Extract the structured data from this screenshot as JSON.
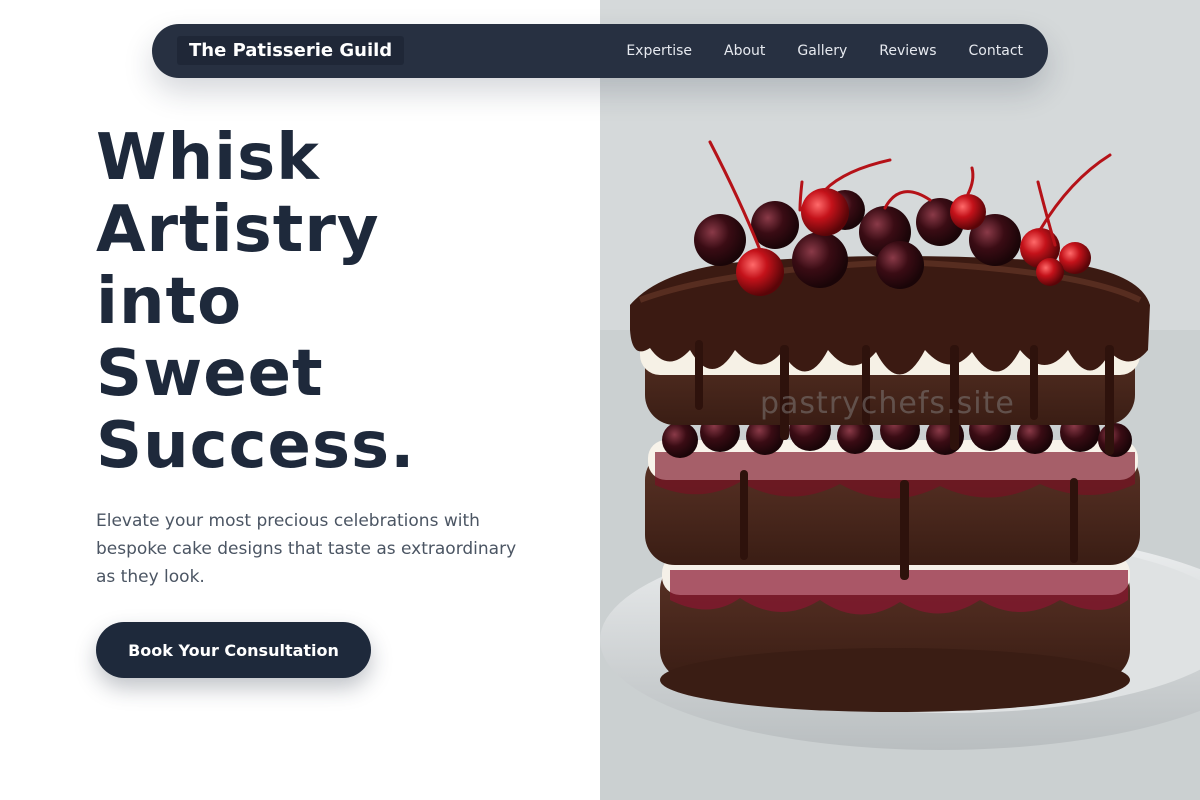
{
  "nav": {
    "brand": "The Patisserie Guild",
    "links": [
      {
        "label": "Expertise"
      },
      {
        "label": "About"
      },
      {
        "label": "Gallery"
      },
      {
        "label": "Reviews"
      },
      {
        "label": "Contact"
      }
    ]
  },
  "hero": {
    "headline_lines": [
      "Whisk",
      "Artistry",
      "into",
      "Sweet",
      "Success."
    ],
    "subtitle": "Elevate your most precious celebrations with bespoke cake designs that taste as extraordinary as they look.",
    "cta_label": "Book Your Consultation"
  },
  "image": {
    "watermark": "pastrychefs.site"
  },
  "colors": {
    "nav_bg": "#273041",
    "headline": "#1e293b",
    "cta_bg": "#1e293b",
    "body_text": "#4b5563"
  }
}
